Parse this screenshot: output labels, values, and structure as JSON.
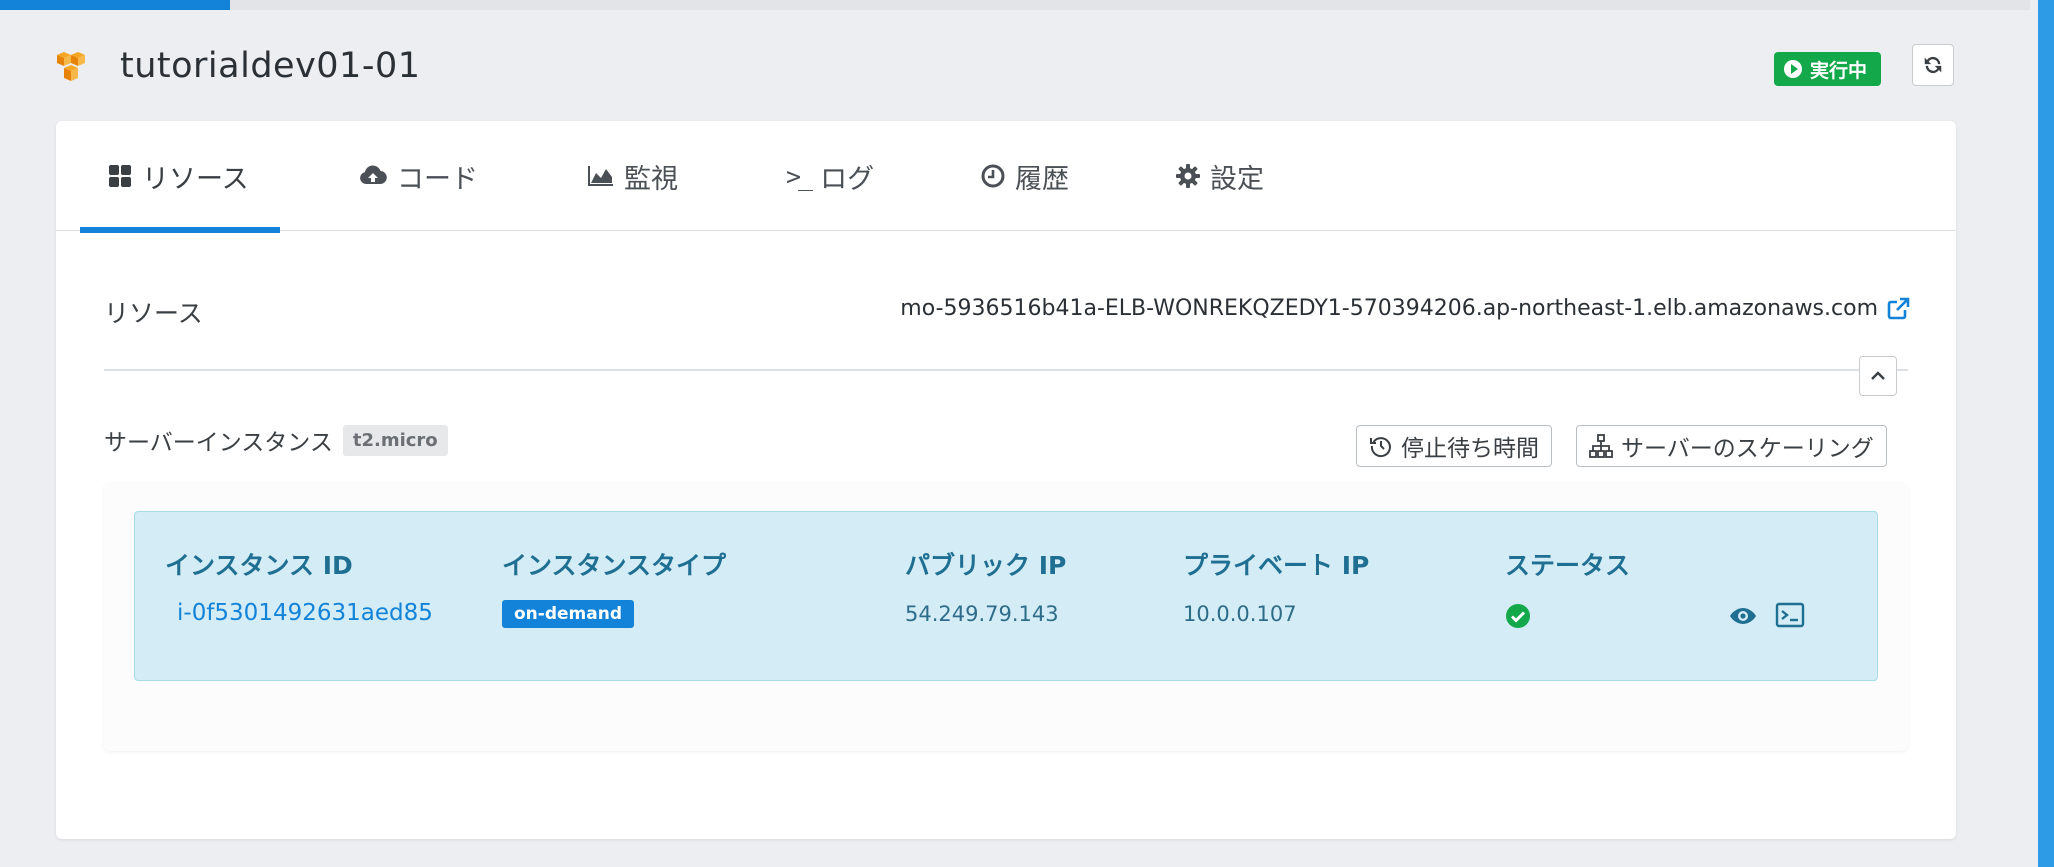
{
  "header": {
    "title": "tutorialdev01-01",
    "status": "実行中",
    "icons": {
      "app": "aws-cubes-icon",
      "status": "play-circle-icon",
      "refresh": "refresh-icon"
    },
    "load_progress": 0.112
  },
  "tabs": [
    {
      "label": "リソース",
      "icon": "grid-icon",
      "active": true
    },
    {
      "label": "コード",
      "icon": "cloud-upload-icon",
      "active": false
    },
    {
      "label": "監視",
      "icon": "area-chart-icon",
      "active": false
    },
    {
      "label": "ログ",
      "icon": "terminal-prompt-icon",
      "active": false
    },
    {
      "label": "履歴",
      "icon": "clock-icon",
      "active": false
    },
    {
      "label": "設定",
      "icon": "gear-icon",
      "active": false
    }
  ],
  "resources": {
    "label": "リソース",
    "elb_host": "mo-5936516b41a-ELB-WONREKQZEDY1-570394206.ap-northeast-1.elb.amazonaws.com"
  },
  "server": {
    "label": "サーバーインスタンス",
    "type_tag": "t2.micro",
    "buttons": {
      "stop_wait": "停止待ち時間",
      "scaling": "サーバーのスケーリング"
    }
  },
  "table": {
    "headers": [
      "インスタンス ID",
      "インスタンスタイプ",
      "パブリック IP",
      "プライベート IP",
      "ステータス"
    ],
    "rows": [
      {
        "id": "i-0f5301492631aed85",
        "type": "on-demand",
        "public_ip": "54.249.79.143",
        "private_ip": "10.0.0.107",
        "status": "ok"
      }
    ]
  },
  "colors": {
    "accent": "#1283d8",
    "running": "#13a849",
    "row_bg": "#d3ecf5",
    "header_text": "#1f6f93"
  }
}
